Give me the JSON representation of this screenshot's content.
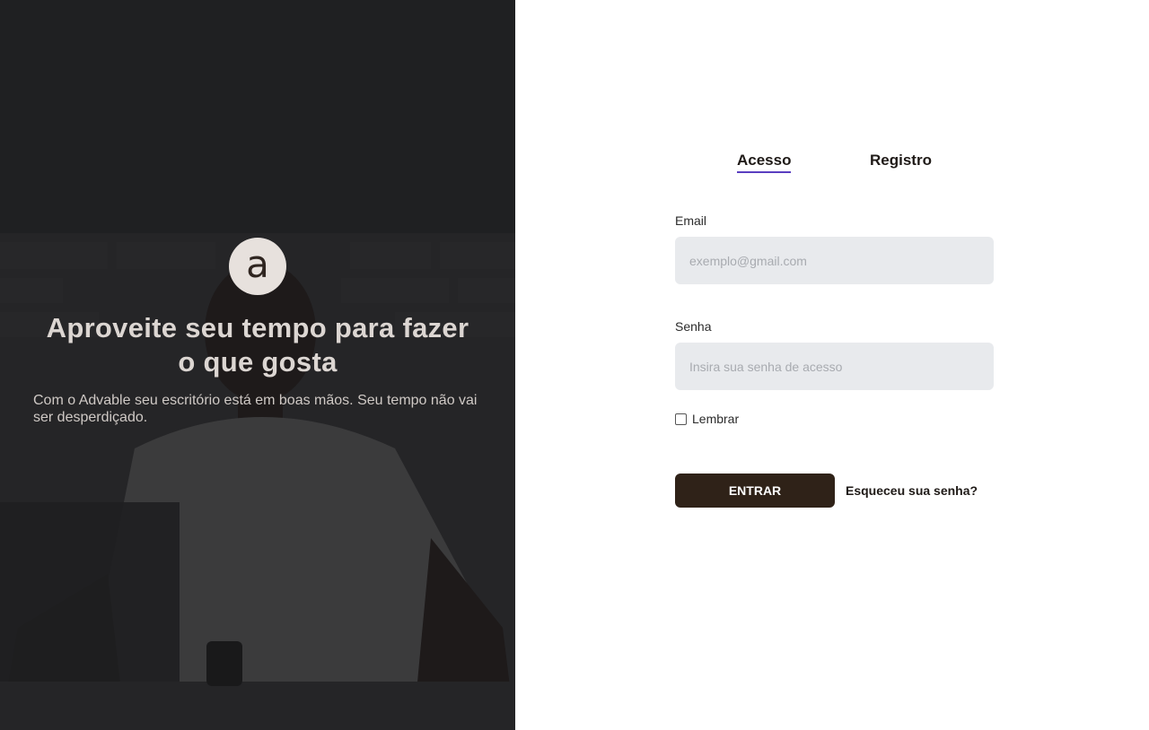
{
  "hero": {
    "logo_letter": "a",
    "title": "Aproveite seu tempo para fazer o que gosta",
    "subtitle": "Com o Advable seu escritório está em boas mãos. Seu tempo não vai ser desperdiçado.",
    "photo_description_icon": "person-with-laptop-photo"
  },
  "tabs": {
    "login_label": "Acesso",
    "register_label": "Registro",
    "active": "Acesso"
  },
  "form": {
    "email_label": "Email",
    "email_placeholder": "exemplo@gmail.com",
    "email_value": "",
    "password_label": "Senha",
    "password_placeholder": "Insira sua senha de acesso",
    "password_value": "",
    "remember_label": "Lembrar",
    "remember_checked": false,
    "submit_label": "ENTRAR",
    "forgot_label": "Esqueceu sua senha?"
  },
  "colors": {
    "accent_underline": "#5a3fc0",
    "button_bg": "#2f2218",
    "input_bg": "#e8eaed",
    "logo_bg": "#e7e1dd"
  }
}
